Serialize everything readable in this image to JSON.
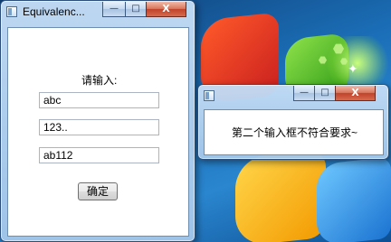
{
  "main_window": {
    "title": "Equivalenc...",
    "prompt": "请输入:",
    "fields": [
      {
        "value": "abc"
      },
      {
        "value": "123.."
      },
      {
        "value": "ab112"
      }
    ],
    "ok_label": "确定",
    "controls": {
      "minimize": "—",
      "maximize": "□",
      "close": "X"
    }
  },
  "message_window": {
    "title": "",
    "message": "第二个输入框不符合要求~",
    "controls": {
      "minimize": "—",
      "maximize": "□",
      "close": "X"
    }
  }
}
